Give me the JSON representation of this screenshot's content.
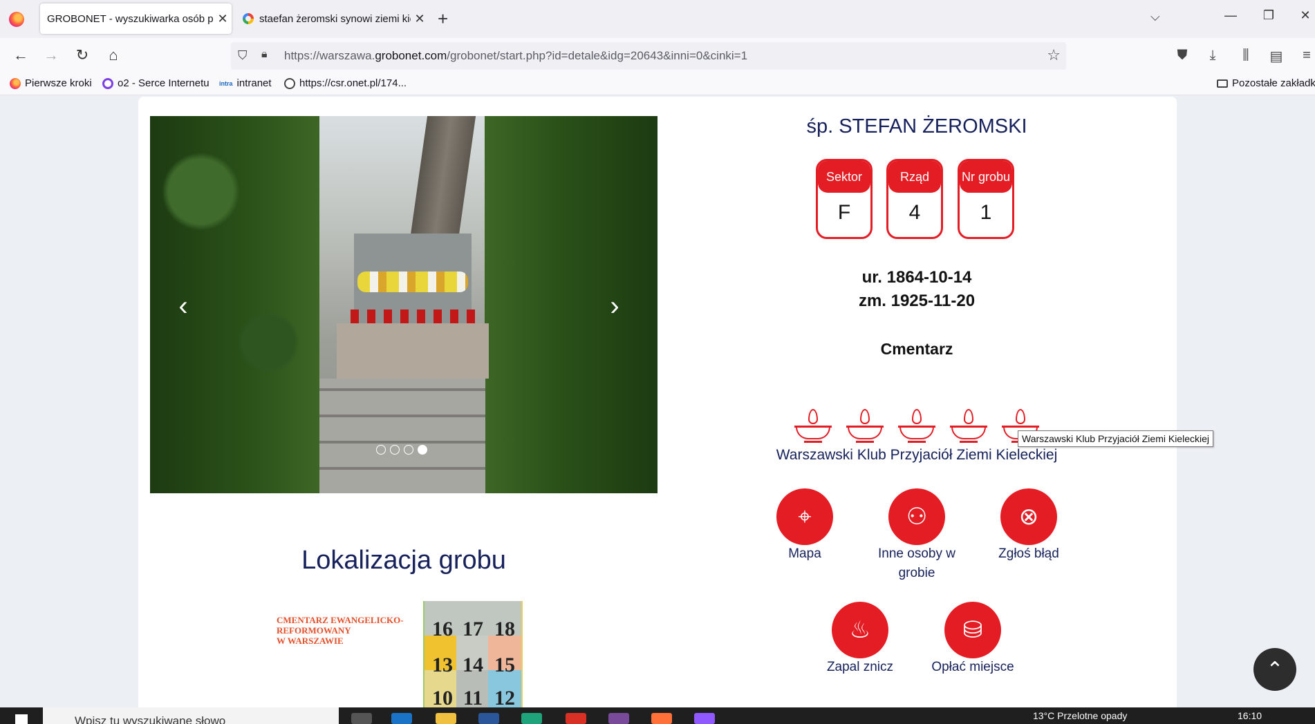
{
  "browser": {
    "tabs": [
      {
        "title": "GROBONET - wyszukiwarka osób pochowanych",
        "active": true
      },
      {
        "title": "staefan żeromski synowi ziemi kieleckiej",
        "active": false
      }
    ],
    "url_prefix": "https://warszawa.",
    "url_domain": "grobonet.com",
    "url_suffix": "/grobonet/start.php?id=detale&idg=20643&inni=0&cinki=1",
    "bookmarks": [
      "Pierwsze kroki",
      "o2 - Serce Internetu",
      "intranet",
      "https://csr.onet.pl/174..."
    ],
    "bookmark_intra_icon": "intra",
    "other_bookmarks": "Pozostałe zakładki"
  },
  "person": {
    "title": "śp. STEFAN ŻEROMSKI",
    "sector_label": "Sektor",
    "sector": "F",
    "row_label": "Rząd",
    "row": "4",
    "grave_label": "Nr grobu",
    "grave": "1",
    "born": "ur. 1864-10-14",
    "died": "zm. 1925-11-20",
    "cemetery_label": "Cmentarz"
  },
  "candles": {
    "count": 5,
    "club": "Warszawski Klub Przyjaciół Ziemi Kieleckiej",
    "tooltip": "Warszawski Klub Przyjaciół Ziemi Kieleckiej"
  },
  "actions": {
    "map": "Mapa",
    "others": "Inne osoby w grobie",
    "report": "Zgłoś błąd",
    "candle": "Zapal znicz",
    "pay": "Opłać miejsce"
  },
  "carousel": {
    "slides": 4,
    "active_slide": 4
  },
  "location": {
    "title": "Lokalizacja grobu",
    "map_label_line1": "CMENTARZ EWANGELICKO-",
    "map_label_line2": "REFORMOWANY",
    "map_label_line3": "W WARSZAWIE",
    "grid": [
      "16",
      "17",
      "18",
      "13",
      "14",
      "15",
      "10",
      "11",
      "12"
    ]
  },
  "taskbar": {
    "search_placeholder": "Wpisz tu wyszukiwane słowo",
    "weather": "13°C  Przelotne opady",
    "time": "16:10"
  },
  "colors": {
    "accent": "#e41d25",
    "navy": "#16215c"
  }
}
